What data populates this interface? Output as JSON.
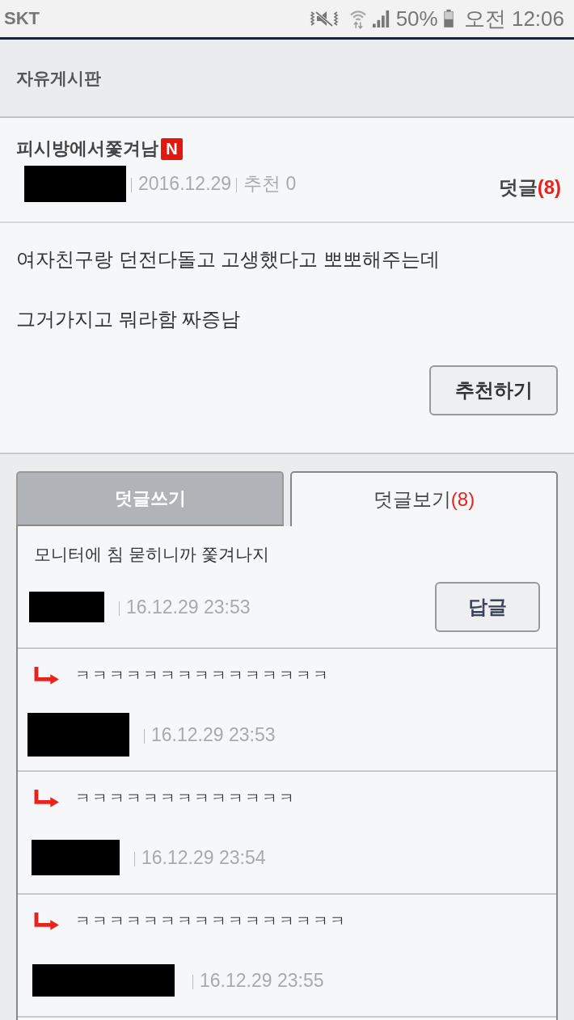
{
  "status_bar": {
    "carrier": "SKT",
    "battery": "50%",
    "time": "오전 12:06"
  },
  "header": {
    "title": "자유게시판"
  },
  "post": {
    "title": "피시방에서쫓겨남",
    "new_badge": "N",
    "date": "2016.12.29",
    "recommend": "추천 0",
    "comments_label": "덧글",
    "comments_count": "(8)",
    "body": [
      "여자친구랑 던전다돌고 고생했다고 뽀뽀해주는데",
      "그거가지고 뭐라함 짜증남"
    ],
    "recommend_button": "추천하기"
  },
  "tabs": [
    {
      "label": "덧글쓰기",
      "selected": false
    },
    {
      "label": "덧글보기",
      "count": "(8)",
      "selected": true
    }
  ],
  "comments": [
    {
      "kind": "comment",
      "text": "모니터에 침 묻히니까 쫓겨나지",
      "date": "16.12.29 23:53",
      "reply_button": "답글"
    },
    {
      "kind": "reply",
      "text": "ㅋㅋㅋㅋㅋㅋㅋㅋㅋㅋㅋㅋㅋㅋㅋ",
      "date": "16.12.29 23:53"
    },
    {
      "kind": "reply",
      "text": "ㅋㅋㅋㅋㅋㅋㅋㅋㅋㅋㅋㅋㅋ",
      "date": "16.12.29 23:54"
    },
    {
      "kind": "reply",
      "text": "ㅋㅋㅋㅋㅋㅋㅋㅋㅋㅋㅋㅋㅋㅋㅋㅋ",
      "date": "16.12.29 23:55"
    }
  ]
}
